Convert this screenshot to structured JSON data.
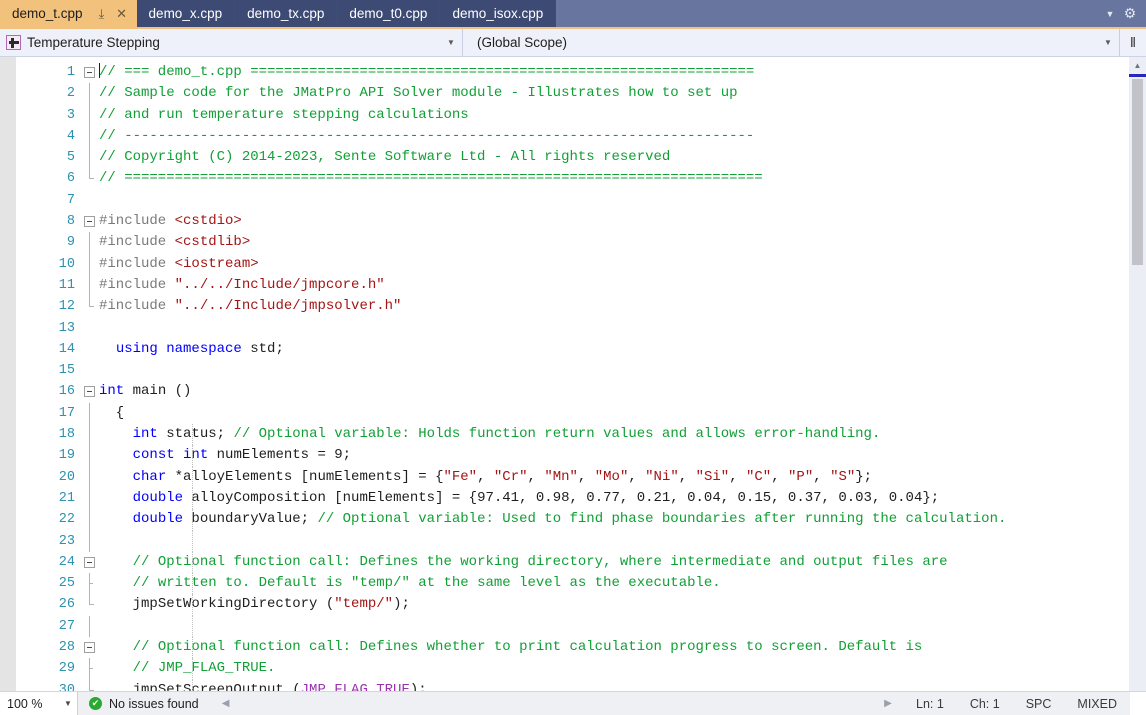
{
  "tabs": {
    "items": [
      {
        "label": "demo_t.cpp",
        "active": true
      },
      {
        "label": "demo_x.cpp",
        "active": false
      },
      {
        "label": "demo_tx.cpp",
        "active": false
      },
      {
        "label": "demo_t0.cpp",
        "active": false
      },
      {
        "label": "demo_isox.cpp",
        "active": false
      }
    ],
    "pin_icon": "⤓",
    "close_icon": "✕",
    "overflow_icon": "▼",
    "settings_icon": "⚙",
    "active_bg": "#f2c17c",
    "inactive_bg": "#3d4a74",
    "strip_bg": "#68759e"
  },
  "navbar": {
    "project_label": "Temperature Stepping",
    "scope_label": "(Global Scope)",
    "dropdown_icon": "▼",
    "split_icon": "⫴",
    "project_glyph": "project-icon"
  },
  "editor": {
    "line_number_color": "#2b91af",
    "first_line": 1,
    "lines": [
      {
        "n": 1,
        "fold": "open",
        "indent": [],
        "parts": [
          {
            "t": "caret",
            "v": ""
          },
          {
            "t": "cm",
            "v": "// === demo_t.cpp ============================================================"
          }
        ]
      },
      {
        "n": 2,
        "fold": "bar",
        "indent": [],
        "parts": [
          {
            "t": "cm",
            "v": "// Sample code for the JMatPro API Solver module - Illustrates how to set up"
          }
        ]
      },
      {
        "n": 3,
        "fold": "bar",
        "indent": [],
        "parts": [
          {
            "t": "cm",
            "v": "// and run temperature stepping calculations"
          }
        ]
      },
      {
        "n": 4,
        "fold": "bar",
        "indent": [],
        "parts": [
          {
            "t": "cm",
            "v": "// ---------------------------------------------------------------------------"
          }
        ]
      },
      {
        "n": 5,
        "fold": "bar",
        "indent": [],
        "parts": [
          {
            "t": "cm",
            "v": "// Copyright (C) 2014-2023, Sente Software Ltd - All rights reserved"
          }
        ]
      },
      {
        "n": 6,
        "fold": "end",
        "indent": [],
        "parts": [
          {
            "t": "cm",
            "v": "// ============================================================================"
          }
        ]
      },
      {
        "n": 7,
        "fold": "none",
        "indent": [],
        "parts": []
      },
      {
        "n": 8,
        "fold": "open",
        "indent": [],
        "parts": [
          {
            "t": "pp",
            "v": "#include "
          },
          {
            "t": "st",
            "v": "<cstdio>"
          }
        ]
      },
      {
        "n": 9,
        "fold": "bar",
        "indent": [],
        "parts": [
          {
            "t": "pp",
            "v": "#include "
          },
          {
            "t": "st",
            "v": "<cstdlib>"
          }
        ]
      },
      {
        "n": 10,
        "fold": "bar",
        "indent": [],
        "parts": [
          {
            "t": "pp",
            "v": "#include "
          },
          {
            "t": "st",
            "v": "<iostream>"
          }
        ]
      },
      {
        "n": 11,
        "fold": "bar",
        "indent": [],
        "parts": [
          {
            "t": "pp",
            "v": "#include "
          },
          {
            "t": "st",
            "v": "\"../../Include/jmpcore.h\""
          }
        ]
      },
      {
        "n": 12,
        "fold": "end",
        "indent": [],
        "parts": [
          {
            "t": "pp",
            "v": "#include "
          },
          {
            "t": "st",
            "v": "\"../../Include/jmpsolver.h\""
          }
        ]
      },
      {
        "n": 13,
        "fold": "none",
        "indent": [],
        "parts": []
      },
      {
        "n": 14,
        "fold": "none",
        "indent": [],
        "parts": [
          {
            "t": "id",
            "v": "  "
          },
          {
            "t": "kw",
            "v": "using namespace"
          },
          {
            "t": "id",
            "v": " std;"
          }
        ]
      },
      {
        "n": 15,
        "fold": "none",
        "indent": [],
        "parts": []
      },
      {
        "n": 16,
        "fold": "open",
        "indent": [],
        "parts": [
          {
            "t": "kw",
            "v": "int"
          },
          {
            "t": "id",
            "v": " main ()"
          }
        ]
      },
      {
        "n": 17,
        "fold": "bar",
        "indent": [],
        "parts": [
          {
            "t": "id",
            "v": "  {"
          }
        ]
      },
      {
        "n": 18,
        "fold": "bar",
        "indent": [
          22
        ],
        "parts": [
          {
            "t": "id",
            "v": "    "
          },
          {
            "t": "kw",
            "v": "int"
          },
          {
            "t": "id",
            "v": " status; "
          },
          {
            "t": "cm",
            "v": "// Optional variable: Holds function return values and allows error-handling."
          }
        ]
      },
      {
        "n": 19,
        "fold": "bar",
        "indent": [
          22
        ],
        "parts": [
          {
            "t": "id",
            "v": "    "
          },
          {
            "t": "kw",
            "v": "const int"
          },
          {
            "t": "id",
            "v": " numElements = 9;"
          }
        ]
      },
      {
        "n": 20,
        "fold": "bar",
        "indent": [
          22
        ],
        "parts": [
          {
            "t": "id",
            "v": "    "
          },
          {
            "t": "kw",
            "v": "char"
          },
          {
            "t": "id",
            "v": " *alloyElements [numElements] = {"
          },
          {
            "t": "st",
            "v": "\"Fe\""
          },
          {
            "t": "id",
            "v": ", "
          },
          {
            "t": "st",
            "v": "\"Cr\""
          },
          {
            "t": "id",
            "v": ", "
          },
          {
            "t": "st",
            "v": "\"Mn\""
          },
          {
            "t": "id",
            "v": ", "
          },
          {
            "t": "st",
            "v": "\"Mo\""
          },
          {
            "t": "id",
            "v": ", "
          },
          {
            "t": "st",
            "v": "\"Ni\""
          },
          {
            "t": "id",
            "v": ", "
          },
          {
            "t": "st",
            "v": "\"Si\""
          },
          {
            "t": "id",
            "v": ", "
          },
          {
            "t": "st",
            "v": "\"C\""
          },
          {
            "t": "id",
            "v": ", "
          },
          {
            "t": "st",
            "v": "\"P\""
          },
          {
            "t": "id",
            "v": ", "
          },
          {
            "t": "st",
            "v": "\"S\""
          },
          {
            "t": "id",
            "v": "};"
          }
        ]
      },
      {
        "n": 21,
        "fold": "bar",
        "indent": [
          22
        ],
        "parts": [
          {
            "t": "id",
            "v": "    "
          },
          {
            "t": "kw",
            "v": "double"
          },
          {
            "t": "id",
            "v": " alloyComposition [numElements] = {97.41, 0.98, 0.77, 0.21, 0.04, 0.15, 0.37, 0.03, 0.04};"
          }
        ]
      },
      {
        "n": 22,
        "fold": "bar",
        "indent": [
          22
        ],
        "parts": [
          {
            "t": "id",
            "v": "    "
          },
          {
            "t": "kw",
            "v": "double"
          },
          {
            "t": "id",
            "v": " boundaryValue; "
          },
          {
            "t": "cm",
            "v": "// Optional variable: Used to find phase boundaries after running the calculation."
          }
        ]
      },
      {
        "n": 23,
        "fold": "bar",
        "indent": [
          22
        ],
        "parts": []
      },
      {
        "n": 24,
        "fold": "open2",
        "indent": [
          22
        ],
        "parts": [
          {
            "t": "id",
            "v": "    "
          },
          {
            "t": "cm",
            "v": "// Optional function call: Defines the working directory, where intermediate and output files are"
          }
        ]
      },
      {
        "n": 25,
        "fold": "bar2",
        "indent": [
          22
        ],
        "parts": [
          {
            "t": "id",
            "v": "    "
          },
          {
            "t": "cm",
            "v": "// written to. Default is \"temp/\" at the same level as the executable."
          }
        ]
      },
      {
        "n": 26,
        "fold": "end2",
        "indent": [
          22
        ],
        "parts": [
          {
            "t": "id",
            "v": "    "
          },
          {
            "t": "id",
            "v": "jmpSetWorkingDirectory ("
          },
          {
            "t": "st",
            "v": "\"temp/\""
          },
          {
            "t": "id",
            "v": ");"
          }
        ]
      },
      {
        "n": 27,
        "fold": "bar",
        "indent": [
          22
        ],
        "parts": []
      },
      {
        "n": 28,
        "fold": "open2",
        "indent": [
          22
        ],
        "parts": [
          {
            "t": "id",
            "v": "    "
          },
          {
            "t": "cm",
            "v": "// Optional function call: Defines whether to print calculation progress to screen. Default is"
          }
        ]
      },
      {
        "n": 29,
        "fold": "bar2",
        "indent": [
          22
        ],
        "parts": [
          {
            "t": "id",
            "v": "    "
          },
          {
            "t": "cm",
            "v": "// JMP_FLAG_TRUE."
          }
        ]
      },
      {
        "n": 30,
        "fold": "end2",
        "indent": [
          22
        ],
        "parts": [
          {
            "t": "id",
            "v": "    "
          },
          {
            "t": "id",
            "v": "jmpSetScreenOutput ("
          },
          {
            "t": "mc",
            "v": "JMP_FLAG_TRUE"
          },
          {
            "t": "id",
            "v": ");"
          }
        ]
      }
    ],
    "colors": {
      "comment": "#11a036",
      "keyword": "#0000ff",
      "string": "#a31515",
      "macro": "#9b32b0",
      "preprocessor": "#7a7a7a",
      "text": "#1e1e1e"
    }
  },
  "scrollbar": {
    "up_icon": "▲",
    "down_icon": "▼"
  },
  "status": {
    "zoom": "100 %",
    "zoom_arrow": "▼",
    "issues_text": "No issues found",
    "ok_icon": "✔",
    "prev_icon": "◀",
    "next_icon": "▶",
    "line": "Ln: 1",
    "col": "Ch: 1",
    "spaces": "SPC",
    "encoding": "MIXED"
  }
}
